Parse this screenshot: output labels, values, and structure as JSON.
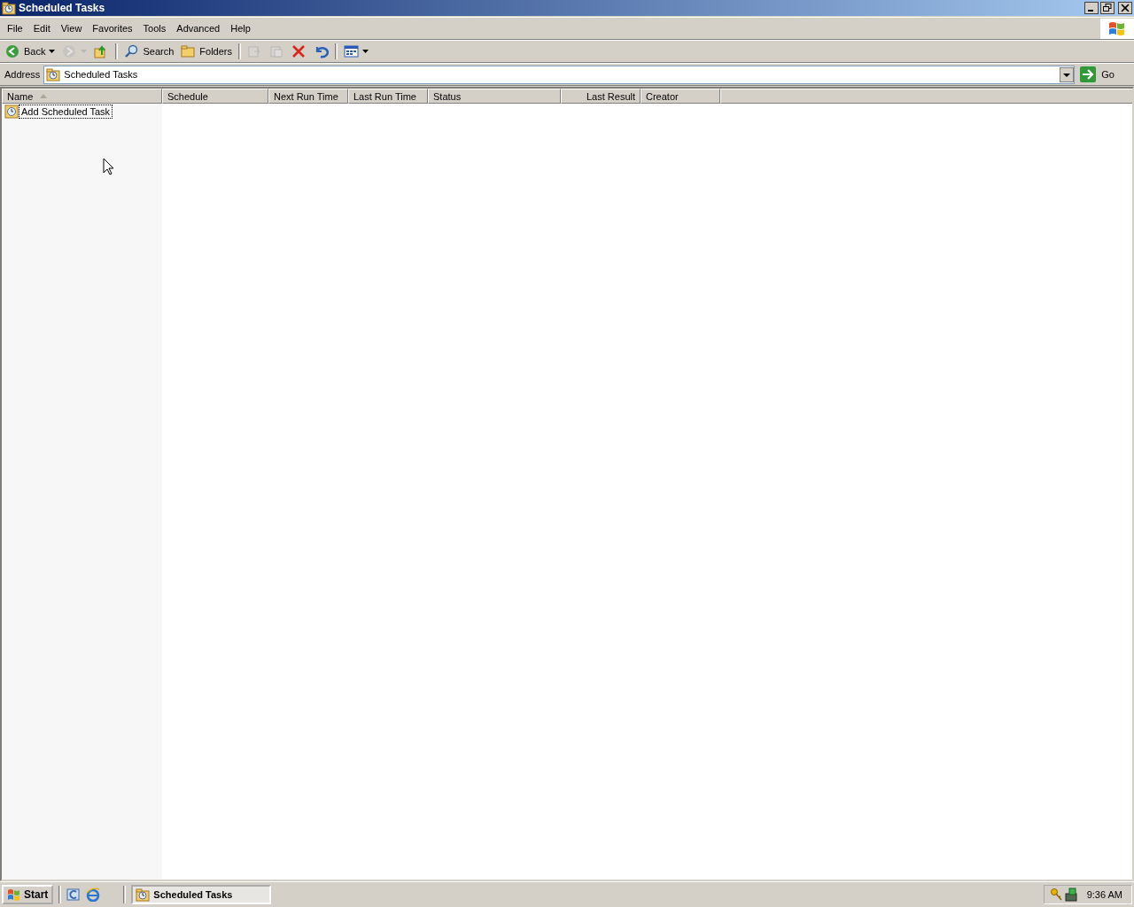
{
  "window": {
    "title": "Scheduled Tasks"
  },
  "menu": [
    {
      "label": "File"
    },
    {
      "label": "Edit"
    },
    {
      "label": "View"
    },
    {
      "label": "Favorites"
    },
    {
      "label": "Tools"
    },
    {
      "label": "Advanced"
    },
    {
      "label": "Help"
    }
  ],
  "toolbar": [
    {
      "kind": "button",
      "label": "Back",
      "disabled": false,
      "dropdown": true
    },
    {
      "kind": "button",
      "disabled": true,
      "dropdown": true
    },
    {
      "kind": "button",
      "disabled": false,
      "dropdown": false
    },
    {
      "kind": "separator"
    },
    {
      "kind": "button",
      "label": "Search",
      "disabled": false,
      "dropdown": false
    },
    {
      "kind": "button",
      "label": "Folders",
      "disabled": false,
      "dropdown": false
    },
    {
      "kind": "separator"
    },
    {
      "kind": "button",
      "disabled": true,
      "dropdown": false
    },
    {
      "kind": "button",
      "disabled": true,
      "dropdown": false
    },
    {
      "kind": "button",
      "disabled": false,
      "dropdown": false
    },
    {
      "kind": "button",
      "disabled": false,
      "dropdown": false
    },
    {
      "kind": "separator"
    },
    {
      "kind": "button",
      "disabled": false,
      "dropdown": true
    }
  ],
  "address": {
    "label": "Address",
    "value": "Scheduled Tasks",
    "go": "Go"
  },
  "table": {
    "columns": [
      {
        "label": "Name",
        "sorted": true,
        "right_aligned": false
      },
      {
        "label": "Schedule",
        "sorted": false,
        "right_aligned": false
      },
      {
        "label": "Next Run Time",
        "sorted": false,
        "right_aligned": false
      },
      {
        "label": "Last Run Time",
        "sorted": false,
        "right_aligned": false
      },
      {
        "label": "Status",
        "sorted": false,
        "right_aligned": false
      },
      {
        "label": "Last Result",
        "sorted": false,
        "right_aligned": true
      },
      {
        "label": "Creator",
        "sorted": false,
        "right_aligned": false
      }
    ],
    "rows": [
      {
        "name": "Add Scheduled Task",
        "focused": true
      }
    ]
  },
  "taskbar": {
    "start": "Start",
    "tasks": [
      {
        "label": "Scheduled Tasks",
        "selected": true
      }
    ],
    "clock": "9:36 AM"
  }
}
